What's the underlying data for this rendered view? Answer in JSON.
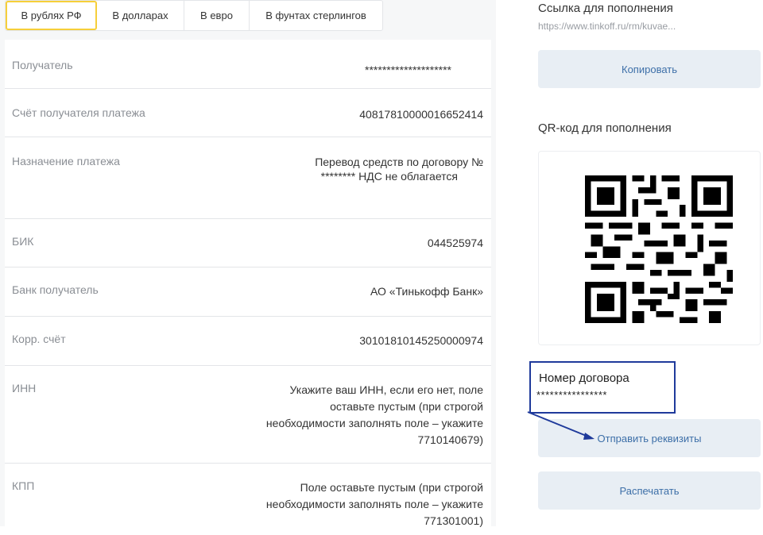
{
  "tabs": [
    {
      "label": "В рублях РФ",
      "active": true
    },
    {
      "label": "В долларах",
      "active": false
    },
    {
      "label": "В евро",
      "active": false
    },
    {
      "label": "В фунтах стерлингов",
      "active": false
    }
  ],
  "details": {
    "recipient_label": "Получатель",
    "recipient_value": "********************",
    "account_label": "Счёт получателя платежа",
    "account_value": "40817810000016652414",
    "purpose_label": "Назначение платежа",
    "purpose_value_1": "Перевод средств по договору №",
    "purpose_value_2": "********  НДС не облагается",
    "bik_label": "БИК",
    "bik_value": "044525974",
    "bank_label": "Банк получатель",
    "bank_value": "АО «Тинькофф Банк»",
    "corr_label": "Корр. счёт",
    "corr_value": "30101810145250000974",
    "inn_label": "ИНН",
    "inn_value_1": "Укажите ваш ИНН, если его нет, поле",
    "inn_value_2": "оставьте пустым (при строгой",
    "inn_value_3": "необходимости заполнять поле – укажите",
    "inn_value_4": "7710140679)",
    "kpp_label": "КПП",
    "kpp_value_1": "Поле оставьте пустым (при строгой",
    "kpp_value_2": "необходимости заполнять поле – укажите",
    "kpp_value_3": "771301001)"
  },
  "right": {
    "link_title": "Ссылка для пополнения",
    "link_url": "https://www.tinkoff.ru/rm/kuvae...",
    "copy_label": "Копировать",
    "qr_title": "QR-код для пополнения",
    "send_label": "Отправить реквизиты",
    "print_label": "Распечатать"
  },
  "callout": {
    "title": "Номер договора",
    "value": "****************"
  },
  "colors": {
    "tab_active_border": "#f6cf3a",
    "button_bg": "#e8eef4",
    "button_text": "#3d6fa8",
    "callout_border": "#1f3a9b"
  }
}
